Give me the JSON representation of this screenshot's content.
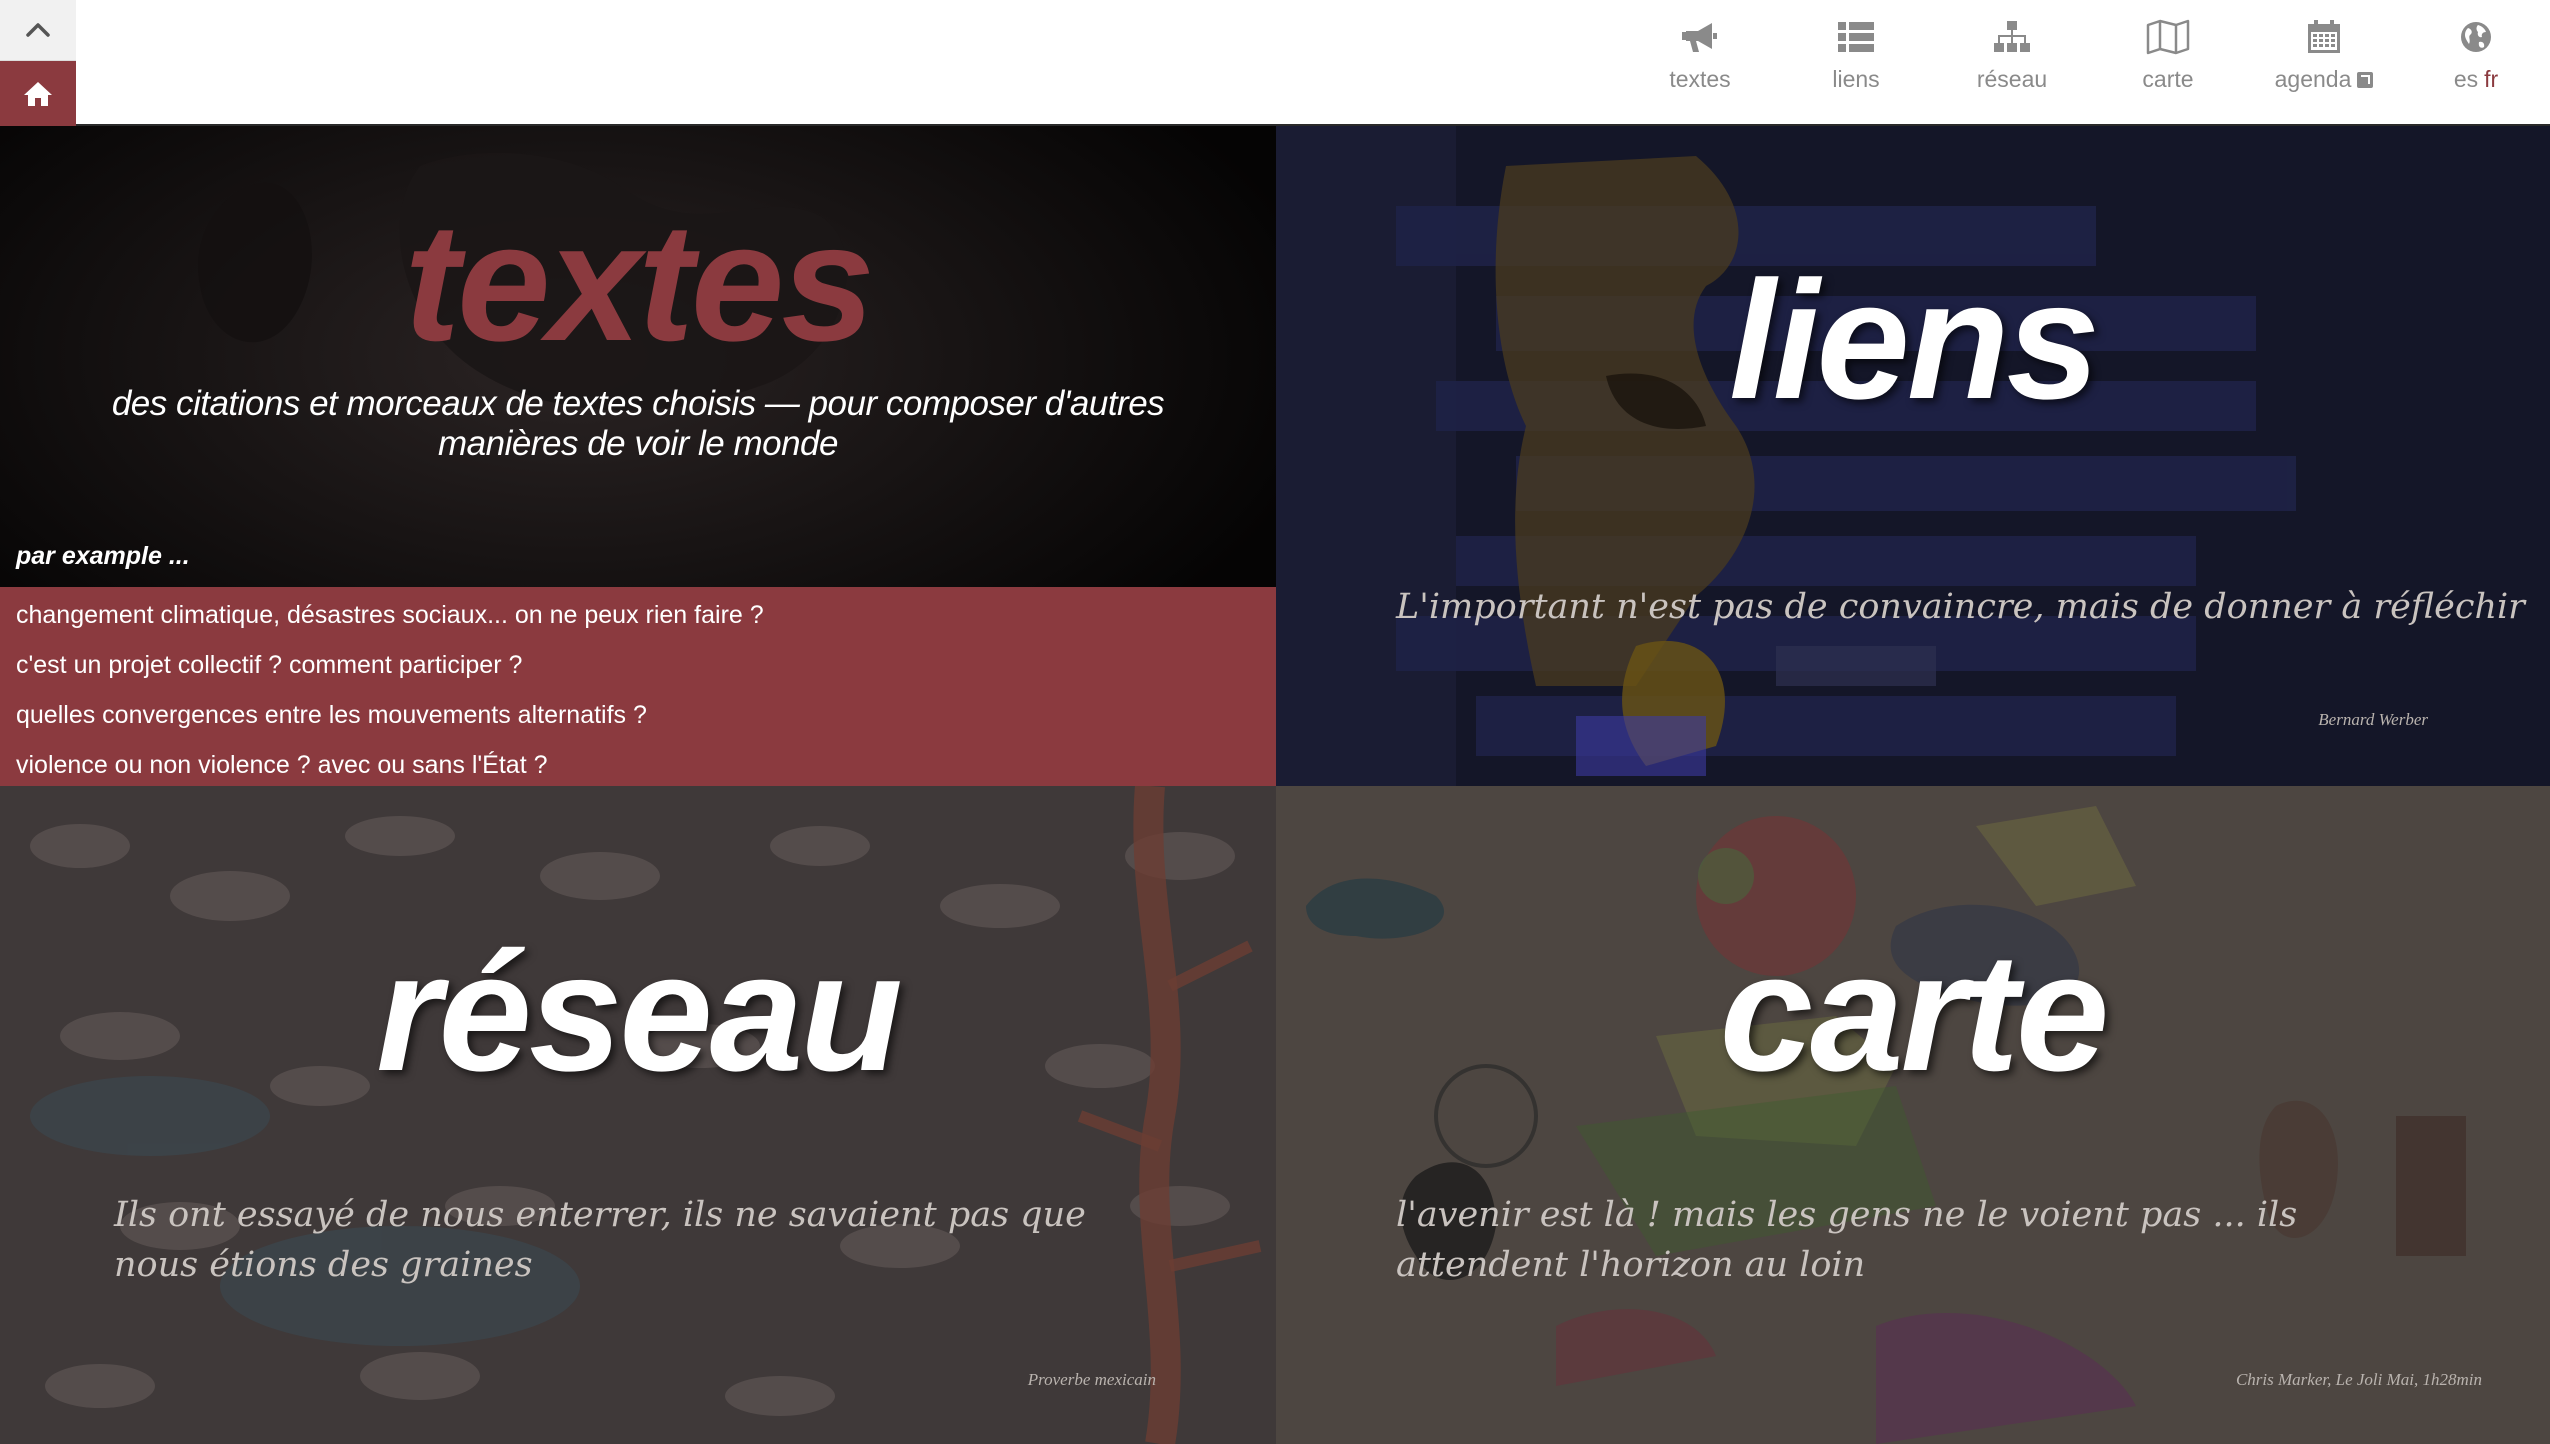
{
  "nav": {
    "items": [
      {
        "label": "textes",
        "icon": "megaphone-icon"
      },
      {
        "label": "liens",
        "icon": "list-icon"
      },
      {
        "label": "réseau",
        "icon": "sitemap-icon"
      },
      {
        "label": "carte",
        "icon": "map-icon"
      },
      {
        "label": "agenda",
        "icon": "calendar-icon"
      }
    ],
    "lang": {
      "icon": "globe-icon",
      "es": "es",
      "fr": "fr",
      "active": "fr"
    }
  },
  "colors": {
    "accent": "#8b3a3f",
    "nav_text": "#8a8a8a"
  },
  "panels": {
    "textes": {
      "title": "textes",
      "subtitle": "des citations et morceaux de textes choisis — pour composer d'autres manières de voir le monde",
      "example_label": "par example ...",
      "questions": [
        "changement climatique, désastres sociaux... on ne peux rien faire ?",
        "c'est un projet collectif ? comment participer ?",
        "quelles convergences entre les mouvements alternatifs ?",
        "violence ou non violence ? avec ou sans l'État ?"
      ]
    },
    "liens": {
      "title": "liens",
      "quote": "L'important n'est pas de convaincre, mais de donner à réfléchir",
      "author": "Bernard Werber"
    },
    "reseau": {
      "title": "réseau",
      "quote": "Ils ont essayé de nous enterrer, ils ne savaient pas que nous étions des graines",
      "author": "Proverbe mexicain"
    },
    "carte": {
      "title": "carte",
      "quote": "l'avenir est là ! mais les gens ne le voient pas ... ils attendent l'horizon au loin",
      "author": "Chris Marker, Le Joli Mai, 1h28min"
    }
  }
}
